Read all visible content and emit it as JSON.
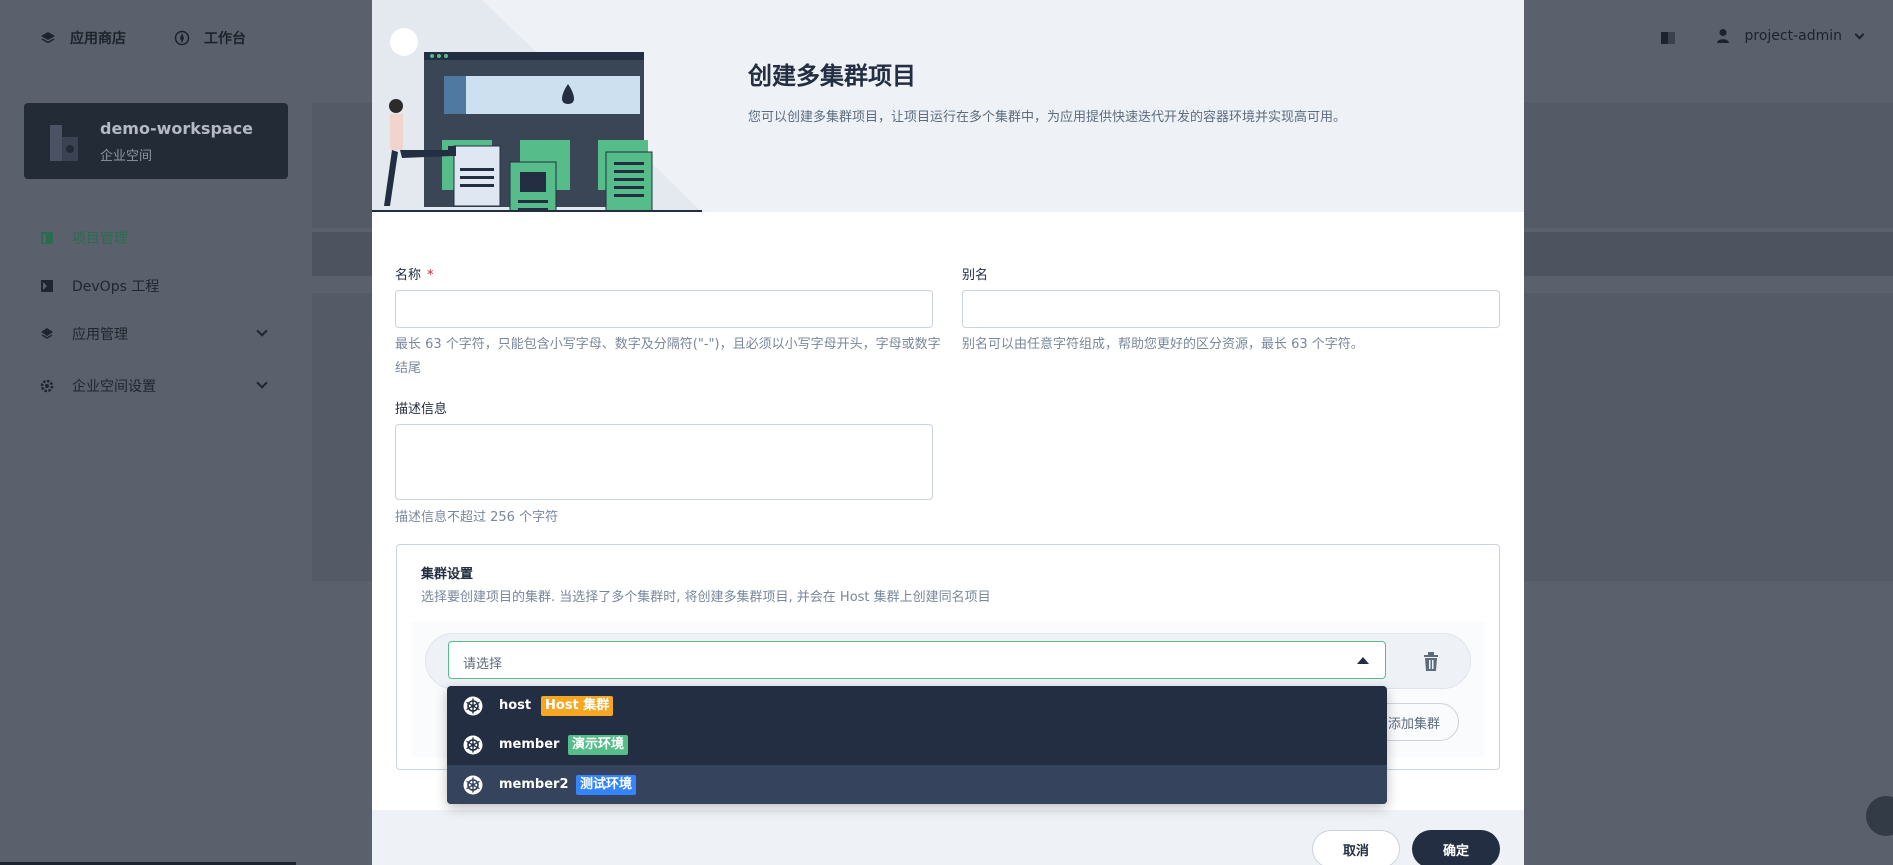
{
  "topnav": {
    "app_store": "应用商店",
    "workbench": "工作台",
    "user": "project-admin"
  },
  "workspace": {
    "name": "demo-workspace",
    "type": "企业空间"
  },
  "sidebar": {
    "items": [
      {
        "label": "项目管理"
      },
      {
        "label": "DevOps 工程"
      },
      {
        "label": "应用管理"
      },
      {
        "label": "企业空间设置"
      }
    ]
  },
  "modal": {
    "title": "创建多集群项目",
    "description": "您可以创建多集群项目，让项目运行在多个集群中，为应用提供快速迭代开发的容器环境并实现高可用。",
    "name_label": "名称",
    "name_required": "*",
    "name_value": "",
    "name_hint": "最长 63 个字符，只能包含小写字母、数字及分隔符(\"-\")，且必须以小写字母开头，字母或数字结尾",
    "alias_label": "别名",
    "alias_value": "",
    "alias_hint": "别名可以由任意字符组成，帮助您更好的区分资源，最长 63 个字符。",
    "desc_label": "描述信息",
    "desc_value": "",
    "desc_hint": "描述信息不超过 256 个字符",
    "cluster": {
      "title": "集群设置",
      "description": "选择要创建项目的集群. 当选择了多个集群时, 将创建多集群项目, 并会在 Host 集群上创建同名项目",
      "select_placeholder": "请选择",
      "add_label": "添加集群",
      "options": [
        {
          "name": "host",
          "tag": "Host 集群",
          "tag_color": "#f5a623"
        },
        {
          "name": "member",
          "tag": "演示环境",
          "tag_color": "#55bc8a"
        },
        {
          "name": "member2",
          "tag": "测试环境",
          "tag_color": "#3385ff"
        }
      ]
    },
    "cancel_label": "取消",
    "ok_label": "确定"
  },
  "colors": {
    "accent": "#55bc8a",
    "dark": "#242e42"
  }
}
